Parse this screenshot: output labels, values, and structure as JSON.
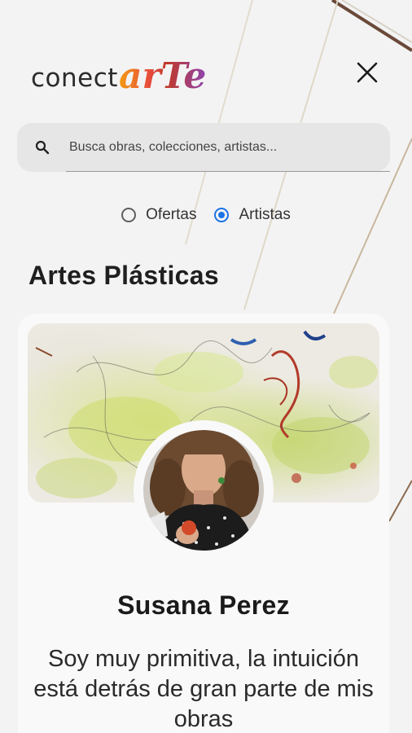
{
  "header": {
    "logo_prefix": "conect",
    "logo_accent": "arTe",
    "close_icon": "close-icon"
  },
  "search": {
    "placeholder": "Busca obras, colecciones, artistas...",
    "value": "",
    "icon": "search-icon"
  },
  "filter": {
    "options": [
      {
        "label": "Ofertas",
        "selected": false
      },
      {
        "label": "Artistas",
        "selected": true
      }
    ]
  },
  "section": {
    "title": "Artes Plásticas"
  },
  "artist_card": {
    "name": "Susana Perez",
    "bio": "Soy muy primitiva, la intuición está detrás de gran parte de mis obras"
  },
  "colors": {
    "accent": "#1a73e8",
    "logo_gradient": [
      "#f39c12",
      "#e74c3c",
      "#8e44ad"
    ],
    "background": "#f3f3f3",
    "card": "#f9f9f9"
  }
}
